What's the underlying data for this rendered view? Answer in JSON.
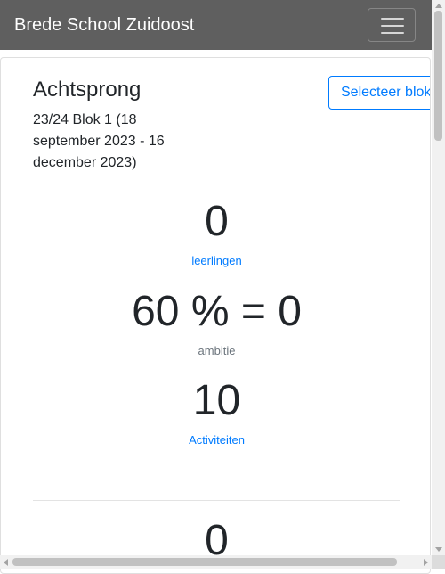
{
  "navbar": {
    "brand": "Brede School Zuidoost",
    "toggler_icon": "hamburger-icon"
  },
  "card": {
    "title": "Achtsprong",
    "period": "23/24 Blok 1 (18 september 2023 - 16 december 2023)",
    "select_button": "Selecteer blok"
  },
  "stats": [
    {
      "value": "0",
      "label": "leerlingen"
    },
    {
      "value": "60 % = 0",
      "label": "ambitie"
    },
    {
      "value": "10",
      "label": "Activiteiten"
    },
    {
      "value": "0",
      "label": ""
    }
  ]
}
